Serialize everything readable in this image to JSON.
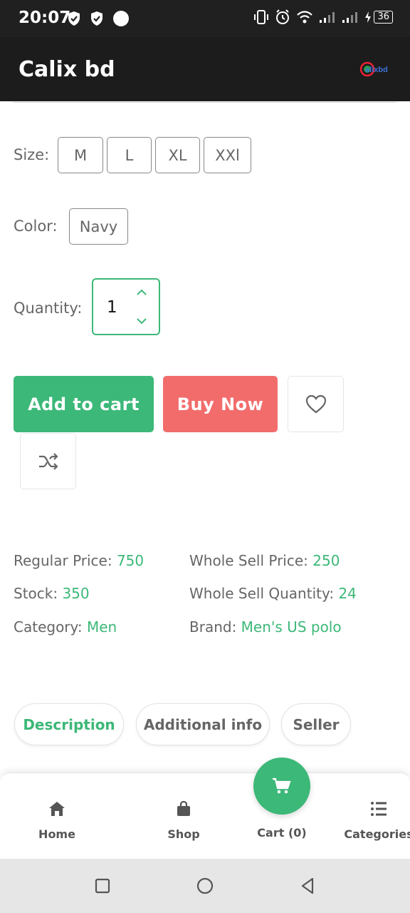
{
  "status_bar": {
    "time": "20:07",
    "battery": "36",
    "icons": [
      "shield-check-icon",
      "shield-check-icon",
      "circle-icon",
      "vibrate-icon",
      "alarm-icon",
      "wifi-icon",
      "signal-icon",
      "signal-icon",
      "charging-icon",
      "battery-icon"
    ]
  },
  "app_bar": {
    "title": "Calix bd",
    "logo_text": "calixbd"
  },
  "options": {
    "size_label": "Size:",
    "sizes": [
      "M",
      "L",
      "XL",
      "XXl"
    ],
    "color_label": "Color:",
    "colors": [
      "Navy"
    ],
    "quantity_label": "Quantity:",
    "quantity_value": "1"
  },
  "actions": {
    "add_to_cart": "Add to cart",
    "buy_now": "Buy Now",
    "wishlist_icon": "heart-icon",
    "compare_icon": "shuffle-icon"
  },
  "details": {
    "regular_price_label": "Regular Price:",
    "regular_price": "750",
    "wholesale_price_label": "Whole Sell Price:",
    "wholesale_price": "250",
    "stock_label": "Stock:",
    "stock": "350",
    "wholesale_qty_label": "Whole Sell Quantity:",
    "wholesale_qty": "24",
    "category_label": "Category:",
    "category": "Men",
    "brand_label": "Brand:",
    "brand": "Men's US polo"
  },
  "tabs": [
    {
      "label": "Description",
      "active": true
    },
    {
      "label": "Additional info",
      "active": false
    },
    {
      "label": "Seller",
      "active": false
    }
  ],
  "bottom_nav": {
    "home": "Home",
    "shop": "Shop",
    "cart": "Cart (0)",
    "categories": "Categories"
  },
  "colors": {
    "accent": "#3cb878",
    "buy_now": "#f26c6c",
    "app_bar": "#1c1c1c"
  }
}
